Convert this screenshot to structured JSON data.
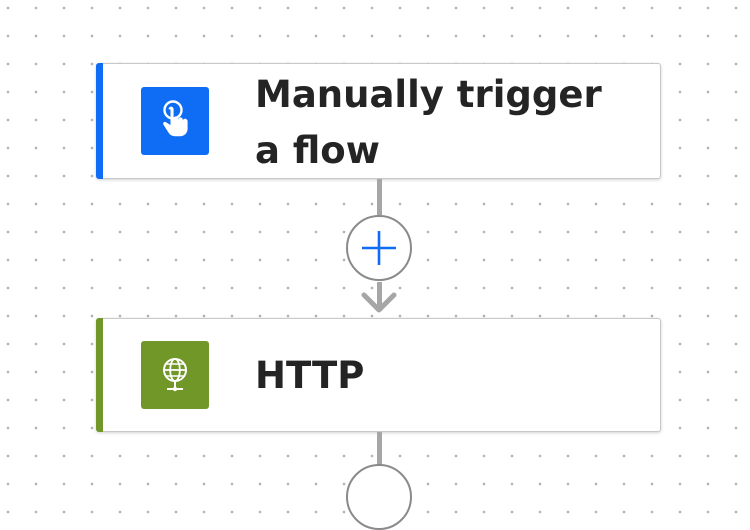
{
  "flow": {
    "steps": [
      {
        "title": "Manually trigger a flow",
        "icon": "hand-pointer-icon",
        "icon_bg": "#0f6cf5",
        "accent": "#0f6cf5"
      },
      {
        "title": "HTTP",
        "icon": "globe-icon",
        "icon_bg": "#709727",
        "accent": "#709727"
      }
    ],
    "add_step_icon": "plus-icon",
    "connector_color": "#a6a6a6",
    "plus_color": "#0f6cf5"
  }
}
